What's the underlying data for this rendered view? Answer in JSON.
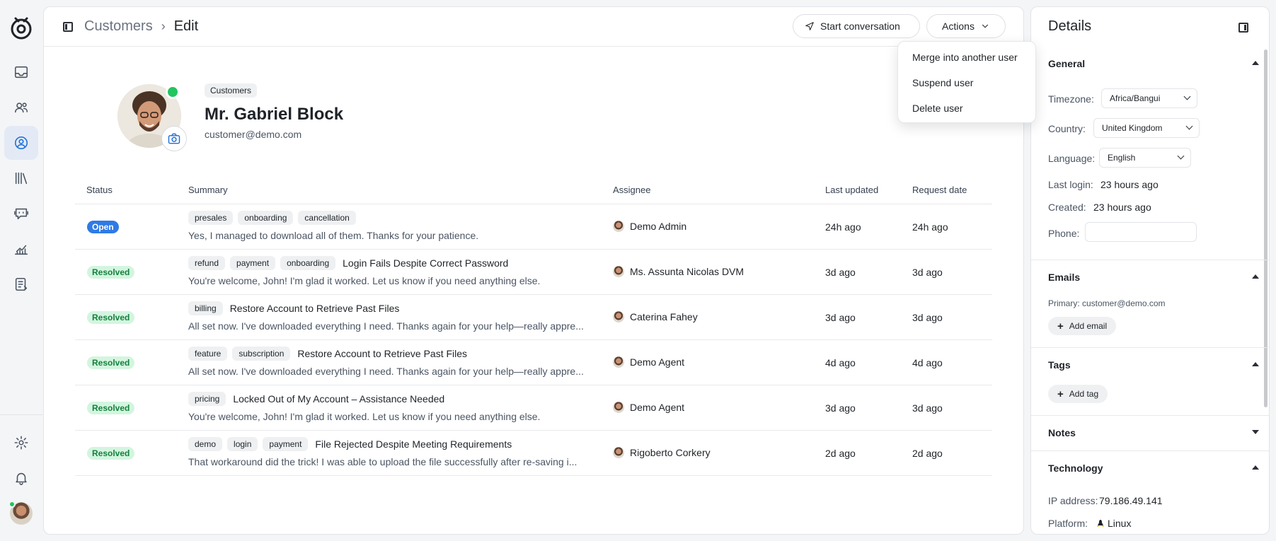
{
  "breadcrumb": {
    "parent": "Customers",
    "current": "Edit"
  },
  "toolbar": {
    "start_conversation": "Start conversation",
    "actions": "Actions"
  },
  "actions_menu": [
    {
      "label": "Merge into another user"
    },
    {
      "label": "Suspend user"
    },
    {
      "label": "Delete user"
    }
  ],
  "customer": {
    "badge": "Customers",
    "name": "Mr. Gabriel Block",
    "email": "customer@demo.com"
  },
  "table": {
    "headers": [
      "Status",
      "Summary",
      "Assignee",
      "Last updated",
      "Request date"
    ],
    "rows": [
      {
        "status": "Open",
        "tags": [
          "presales",
          "onboarding",
          "cancellation"
        ],
        "title": "",
        "preview": "Yes, I managed to download all of them. Thanks for your patience.",
        "assignee": "Demo Admin",
        "updated": "24h ago",
        "requested": "24h ago"
      },
      {
        "status": "Resolved",
        "tags": [
          "refund",
          "payment",
          "onboarding"
        ],
        "title": "Login Fails Despite Correct Password",
        "preview": "You're welcome, John! I'm glad it worked. Let us know if you need anything else.",
        "assignee": "Ms. Assunta Nicolas DVM",
        "updated": "3d ago",
        "requested": "3d ago"
      },
      {
        "status": "Resolved",
        "tags": [
          "billing"
        ],
        "title": "Restore Account to Retrieve Past Files",
        "preview": "All set now. I've downloaded everything I need. Thanks again for your help—really appre...",
        "assignee": "Caterina Fahey",
        "updated": "3d ago",
        "requested": "3d ago"
      },
      {
        "status": "Resolved",
        "tags": [
          "feature",
          "subscription"
        ],
        "title": "Restore Account to Retrieve Past Files",
        "preview": "All set now. I've downloaded everything I need. Thanks again for your help—really appre...",
        "assignee": "Demo Agent",
        "updated": "4d ago",
        "requested": "4d ago"
      },
      {
        "status": "Resolved",
        "tags": [
          "pricing"
        ],
        "title": "Locked Out of My Account – Assistance Needed",
        "preview": "You're welcome, John! I'm glad it worked. Let us know if you need anything else.",
        "assignee": "Demo Agent",
        "updated": "3d ago",
        "requested": "3d ago"
      },
      {
        "status": "Resolved",
        "tags": [
          "demo",
          "login",
          "payment"
        ],
        "title": "File Rejected Despite Meeting Requirements",
        "preview": "That workaround did the trick! I was able to upload the file successfully after re-saving i...",
        "assignee": "Rigoberto Corkery",
        "updated": "2d ago",
        "requested": "2d ago"
      }
    ]
  },
  "details": {
    "title": "Details",
    "general": {
      "heading": "General",
      "timezone_label": "Timezone:",
      "timezone_value": "Africa/Bangui",
      "country_label": "Country:",
      "country_value": "United Kingdom",
      "language_label": "Language:",
      "language_value": "English",
      "last_login_label": "Last login:",
      "last_login_value": "23 hours ago",
      "created_label": "Created:",
      "created_value": "23 hours ago",
      "phone_label": "Phone:"
    },
    "emails": {
      "heading": "Emails",
      "primary": "Primary: customer@demo.com",
      "add_label": "Add email"
    },
    "tags": {
      "heading": "Tags",
      "add_label": "Add tag"
    },
    "notes": {
      "heading": "Notes"
    },
    "technology": {
      "heading": "Technology",
      "ip_label": "IP address:",
      "ip_value": "79.186.49.141",
      "platform_label": "Platform:",
      "platform_value": "Linux"
    }
  },
  "icons": [
    "logo-icon",
    "inbox-icon",
    "users-icon",
    "user-circle-icon",
    "library-icon",
    "bot-icon",
    "chart-icon",
    "tasks-icon",
    "gear-icon",
    "bell-icon",
    "send-icon",
    "chevron-down-icon",
    "camera-icon",
    "linux-icon"
  ],
  "colors": {
    "accent": "#1d6fd8",
    "open": "#2f7ae5",
    "resolved_bg": "#d3f5df",
    "resolved_fg": "#15803d",
    "online": "#22c55e"
  }
}
